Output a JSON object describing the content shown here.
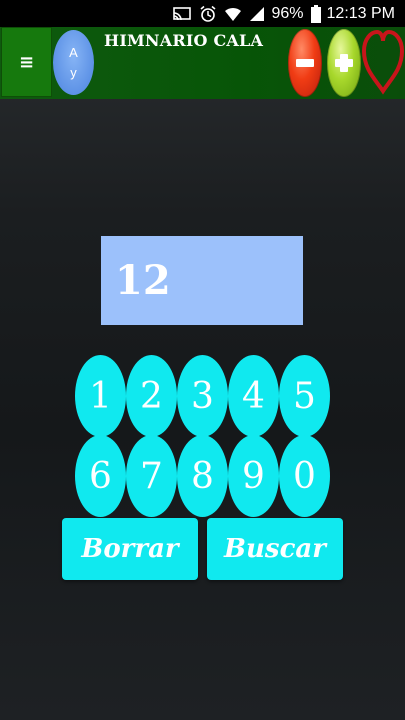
{
  "status_bar": {
    "battery": "96%",
    "time": "12:13 PM",
    "icons": [
      "cast-icon",
      "alarm-icon",
      "wifi-icon",
      "signal-icon",
      "battery-icon"
    ]
  },
  "app_bar": {
    "menu_glyph": "≡",
    "font_button": {
      "line1": "A",
      "line2": "y"
    },
    "title": "HIMNARIO CALA",
    "zoom_out_icon": "minus-icon",
    "zoom_in_icon": "plus-icon",
    "favorite_icon": "heart-icon",
    "colors": {
      "bar": "#075507",
      "zoom_out": "#f03c14",
      "zoom_in": "#a8d82c",
      "heart": "#c8151b"
    }
  },
  "display": {
    "value": "12"
  },
  "keypad": {
    "keys": [
      "1",
      "2",
      "3",
      "4",
      "5",
      "6",
      "7",
      "8",
      "9",
      "0"
    ],
    "clear_label": "Borrar",
    "search_label": "Buscar",
    "accent_color": "#10e9ef"
  }
}
